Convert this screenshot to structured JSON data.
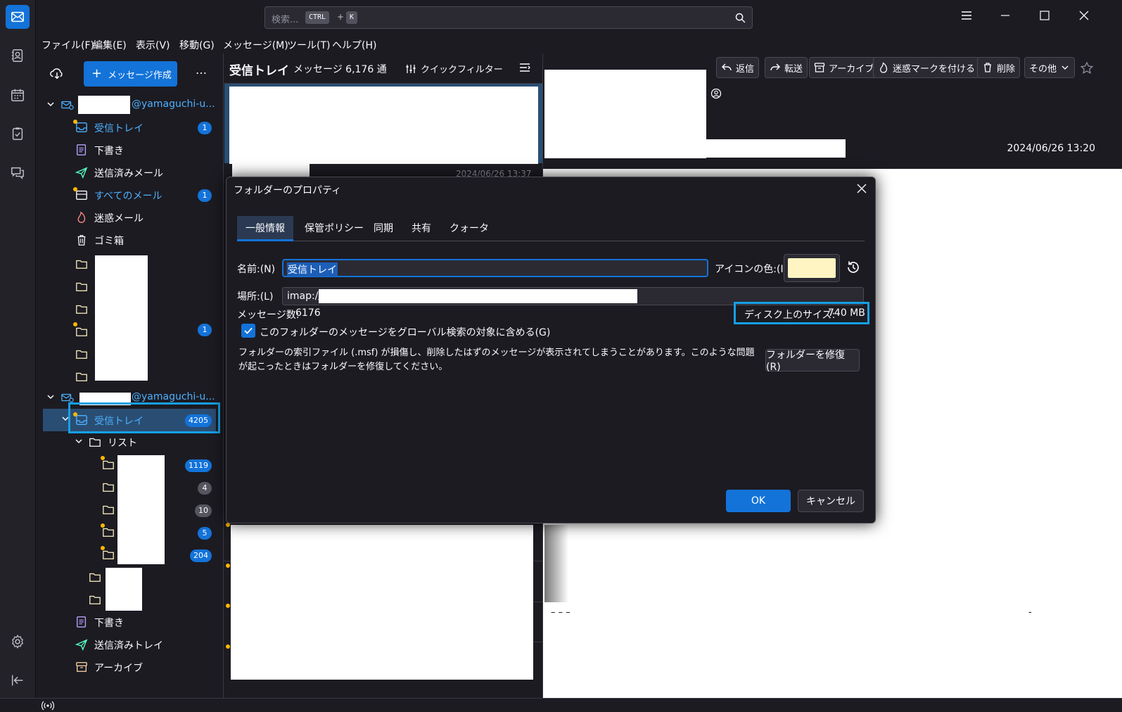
{
  "search": {
    "placeholder": "検索...",
    "key1": "CTRL",
    "plus": "+",
    "key2": "K"
  },
  "menu": [
    "ファイル(F)",
    "編集(E)",
    "表示(V)",
    "移動(G)",
    "メッセージ(M)",
    "ツール(T)",
    "ヘルプ(H)"
  ],
  "folder_pane": {
    "compose_label": "メッセージ作成",
    "more_label": "…",
    "account1": {
      "suffix": "@yamaguchi-u..."
    },
    "account1_folders": [
      {
        "label": "受信トレイ",
        "badge": "1"
      },
      {
        "label": "下書き"
      },
      {
        "label": "送信済みメール"
      },
      {
        "label": "すべてのメール",
        "badge": "1"
      },
      {
        "label": "迷惑メール"
      },
      {
        "label": "ゴミ箱"
      }
    ],
    "account1_extra_badge": "1",
    "account2": {
      "suffix": "@yamaguchi-u..."
    },
    "inbox2": {
      "label": "受信トレイ",
      "badge": "4205"
    },
    "list_folder": {
      "label": "リスト"
    },
    "list_badges": [
      "1119",
      "4",
      "10",
      "5",
      "204"
    ],
    "account2_tail": [
      {
        "label": "下書き"
      },
      {
        "label": "送信済みトレイ"
      },
      {
        "label": "アーカイブ"
      }
    ]
  },
  "thread_pane": {
    "title": "受信トレイ",
    "count": "メッセージ 6,176 通",
    "quick_filter": "クイックフィルター",
    "partial_date": "2024/06/26 13:37"
  },
  "message_header": {
    "buttons": [
      "返信",
      "転送",
      "アーカイブ",
      "迷惑マークを付ける",
      "削除",
      "その他"
    ],
    "date": "2024/06/26 13:20",
    "body_dashes": "– – –",
    "body_dash_right": "-"
  },
  "dialog": {
    "title": "フォルダーのプロパティ",
    "tabs": [
      "一般情報",
      "保管ポリシー",
      "同期",
      "共有",
      "クォータ"
    ],
    "active_tab": 0,
    "name_label": "名前:(N)",
    "name_value": "受信トレイ",
    "icon_color_label": "アイコンの色:(I)",
    "icon_color": "#fff5c2",
    "location_label": "場所:(L)",
    "location_value": "imap://",
    "message_count_label": "メッセージ数:",
    "message_count_value": "6176",
    "disk_size_label": "ディスク上のサイズ:",
    "disk_size_value": "740 MB",
    "global_search_label": "このフォルダーのメッセージをグローバル検索の対象に含める(G)",
    "global_search_checked": true,
    "description": "フォルダーの索引ファイル (.msf) が損傷し、削除したはずのメッセージが表示されてしまうことがあります。このような問題が起こったときはフォルダーを修復してください。",
    "repair_label": "フォルダーを修復(R)",
    "ok_label": "OK",
    "cancel_label": "キャンセル"
  },
  "colors": {
    "accent": "#1373d9",
    "highlight": "#15a0e6",
    "unread_dot": "#ffb800"
  }
}
